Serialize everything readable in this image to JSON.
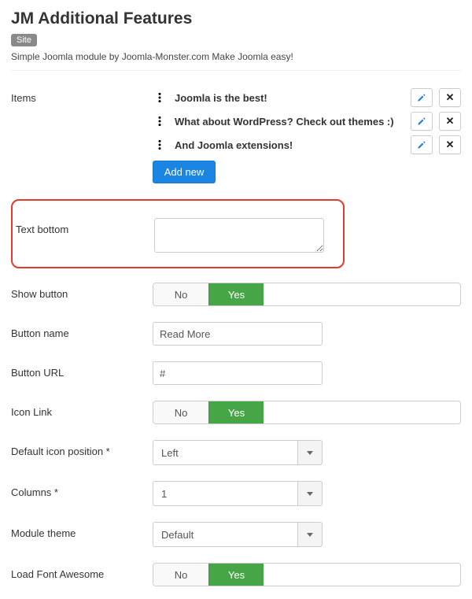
{
  "header": {
    "title": "JM Additional Features",
    "badge": "Site",
    "description": "Simple Joomla module by Joomla-Monster.com Make Joomla easy!"
  },
  "labels": {
    "items": "Items",
    "text_bottom": "Text bottom",
    "show_button": "Show button",
    "button_name": "Button name",
    "button_url": "Button URL",
    "icon_link": "Icon Link",
    "default_icon_position": "Default icon position *",
    "columns": "Columns *",
    "module_theme": "Module theme",
    "load_font_awesome": "Load Font Awesome"
  },
  "items": [
    {
      "text": "Joomla is the best!"
    },
    {
      "text": "What about WordPress? Check out themes :)"
    },
    {
      "text": "And Joomla extensions!"
    }
  ],
  "add_new_label": "Add new",
  "fields": {
    "text_bottom_value": "",
    "show_button": {
      "no": "No",
      "yes": "Yes",
      "value": "yes"
    },
    "button_name_value": "Read More",
    "button_url_value": "#",
    "icon_link": {
      "no": "No",
      "yes": "Yes",
      "value": "yes"
    },
    "default_icon_position_value": "Left",
    "columns_value": "1",
    "module_theme_value": "Default",
    "load_font_awesome": {
      "no": "No",
      "yes": "Yes",
      "value": "yes"
    }
  }
}
